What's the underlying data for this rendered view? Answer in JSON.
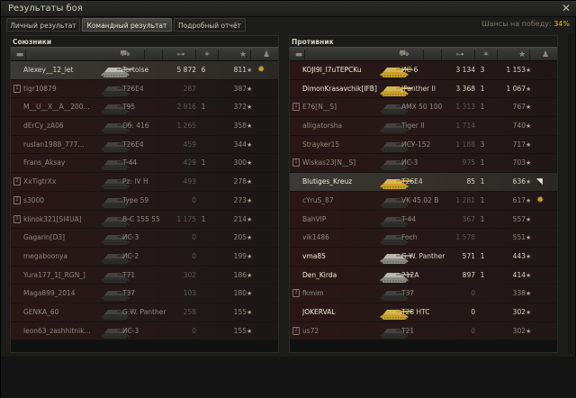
{
  "window": {
    "title": "Результаты боя",
    "close_icon": "close-icon"
  },
  "tabs": [
    {
      "label": "Личный результат",
      "active": false
    },
    {
      "label": "Командный результат",
      "active": true
    },
    {
      "label": "Подробный отчёт",
      "active": false
    }
  ],
  "win_chance": {
    "label": "Шансы на победу:",
    "value": "34%"
  },
  "colors": {
    "accent": "#e8b73c",
    "row_red": "#2b1616",
    "highlight": "#3a3a37",
    "tank_gold": "#c9a128"
  },
  "column_icons": [
    "squad-icon",
    "tank-icon",
    "damage-icon",
    "kills-icon",
    "xp-star-icon",
    "medal-icon"
  ],
  "allies": {
    "title": "Союзники",
    "rows": [
      {
        "squad": false,
        "player": "Alexey__12_let",
        "tank": "Tortoise",
        "damage": "5 872",
        "kills": "6",
        "xp": "811",
        "alive": true,
        "highlight": true,
        "medal": true,
        "tank_color": "gray"
      },
      {
        "squad": true,
        "squad_no": "1",
        "player": "tigr10879",
        "tank": "T26E4",
        "damage": "287",
        "kills": "",
        "xp": "387",
        "alive": false,
        "tank_color": "dark"
      },
      {
        "squad": false,
        "player": "M__U__X__A__200...",
        "tank": "T95",
        "damage": "2 816",
        "kills": "1",
        "xp": "372",
        "alive": false,
        "tank_color": "dark"
      },
      {
        "squad": false,
        "player": "dErCy_zA06",
        "tank": "Об. 416",
        "damage": "1 265",
        "kills": "",
        "xp": "358",
        "alive": false,
        "tank_color": "dark"
      },
      {
        "squad": false,
        "player": "ruslan1988_777...",
        "tank": "T26E4",
        "damage": "459",
        "kills": "",
        "xp": "344",
        "alive": false,
        "tank_color": "dark"
      },
      {
        "squad": false,
        "player": "Frans_Aksay",
        "tank": "T-44",
        "damage": "429",
        "kills": "1",
        "xp": "300",
        "alive": false,
        "tank_color": "dark"
      },
      {
        "squad": true,
        "squad_no": "2",
        "player": "XxTigtrXx",
        "tank": "Pz. IV H",
        "damage": "493",
        "kills": "",
        "xp": "278",
        "alive": false,
        "tank_color": "dark"
      },
      {
        "squad": true,
        "squad_no": "2",
        "player": "s3000",
        "tank": "Type 59",
        "damage": "0",
        "kills": "",
        "xp": "273",
        "alive": false,
        "tank_color": "dark"
      },
      {
        "squad": true,
        "squad_no": "1",
        "player": "klinok321[SI4UA]",
        "tank": "B-C 155 55",
        "damage": "1 175",
        "kills": "1",
        "xp": "214",
        "alive": false,
        "tank_color": "dark"
      },
      {
        "squad": false,
        "player": "Gagarin[D3]",
        "tank": "ИС-3",
        "damage": "0",
        "kills": "",
        "xp": "205",
        "alive": false,
        "tank_color": "dark"
      },
      {
        "squad": false,
        "player": "megaboonya",
        "tank": "ИС-2",
        "damage": "0",
        "kills": "",
        "xp": "199",
        "alive": false,
        "tank_color": "dark"
      },
      {
        "squad": false,
        "player": "Yura177_1[_RGN_]",
        "tank": "T71",
        "damage": "302",
        "kills": "",
        "xp": "186",
        "alive": false,
        "tank_color": "dark"
      },
      {
        "squad": false,
        "player": "Maga899_2014",
        "tank": "T37",
        "damage": "103",
        "kills": "",
        "xp": "180",
        "alive": false,
        "tank_color": "dark"
      },
      {
        "squad": false,
        "player": "GENKA_60",
        "tank": "G.W. Panther",
        "damage": "258",
        "kills": "",
        "xp": "155",
        "alive": false,
        "tank_color": "dark"
      },
      {
        "squad": false,
        "player": "leon63_zashhitnik...",
        "tank": "ИС-3",
        "damage": "0",
        "kills": "",
        "xp": "155",
        "alive": false,
        "tank_color": "dark"
      }
    ]
  },
  "enemies": {
    "title": "Противник",
    "rows": [
      {
        "squad": false,
        "player": "KOJI9I_I7uTEPCKu",
        "tank": "ИС-6",
        "damage": "3 134",
        "kills": "3",
        "xp": "1 153",
        "alive": true,
        "tank_color": "gold"
      },
      {
        "squad": false,
        "player": "DimonKrasavchik[IFB]",
        "tank": "JPanther II",
        "damage": "3 368",
        "kills": "1",
        "xp": "1 067",
        "alive": true,
        "tank_color": "gold"
      },
      {
        "squad": true,
        "squad_no": "1",
        "player": "E76[N__S]",
        "tank": "AMX 50 100",
        "damage": "1 313",
        "kills": "1",
        "xp": "767",
        "alive": false,
        "tank_color": "dark"
      },
      {
        "squad": false,
        "player": "alligatorsha",
        "tank": "Tiger II",
        "damage": "1 714",
        "kills": "",
        "xp": "740",
        "alive": false,
        "tank_color": "dark"
      },
      {
        "squad": false,
        "player": "Strayker15",
        "tank": "ИСУ-152",
        "damage": "1 188",
        "kills": "3",
        "xp": "717",
        "alive": false,
        "tank_color": "dark"
      },
      {
        "squad": true,
        "squad_no": "1",
        "player": "Wiskas23[N__S]",
        "tank": "ИС-3",
        "damage": "975",
        "kills": "1",
        "xp": "703",
        "alive": false,
        "tank_color": "dark"
      },
      {
        "squad": false,
        "player": "Blutiges_Kreuz",
        "tank": "T26E4",
        "damage": "85",
        "kills": "1",
        "xp": "636",
        "alive": true,
        "highlight": true,
        "tank_color": "gold",
        "cursor": true
      },
      {
        "squad": false,
        "player": "cYruS_87",
        "tank": "VK 45.02 B",
        "damage": "1 281",
        "kills": "1",
        "xp": "617",
        "alive": false,
        "medal": true,
        "tank_color": "dark"
      },
      {
        "squad": false,
        "player": "BahVIP",
        "tank": "T-44",
        "damage": "367",
        "kills": "1",
        "xp": "557",
        "alive": false,
        "tank_color": "dark"
      },
      {
        "squad": false,
        "player": "vik1486",
        "tank": "Foch",
        "damage": "1 578",
        "kills": "",
        "xp": "551",
        "alive": false,
        "tank_color": "dark"
      },
      {
        "squad": false,
        "player": "vma85",
        "tank": "G.W. Panther",
        "damage": "571",
        "kills": "1",
        "xp": "443",
        "alive": true,
        "tank_color": "gray"
      },
      {
        "squad": false,
        "player": "Den_Kirda",
        "tank": "212A",
        "damage": "897",
        "kills": "1",
        "xp": "414",
        "alive": true,
        "tank_color": "gray"
      },
      {
        "squad": true,
        "squad_no": "2",
        "player": "fkmim",
        "tank": "T37",
        "damage": "0",
        "kills": "",
        "xp": "338",
        "alive": false,
        "tank_color": "dark"
      },
      {
        "squad": false,
        "player": "JOKERVAL",
        "tank": "T28 HTC",
        "damage": "0",
        "kills": "",
        "xp": "302",
        "alive": true,
        "tank_color": "gold"
      },
      {
        "squad": true,
        "squad_no": "2",
        "player": "us72",
        "tank": "T21",
        "damage": "0",
        "kills": "",
        "xp": "302",
        "alive": false,
        "tank_color": "dark"
      }
    ]
  }
}
